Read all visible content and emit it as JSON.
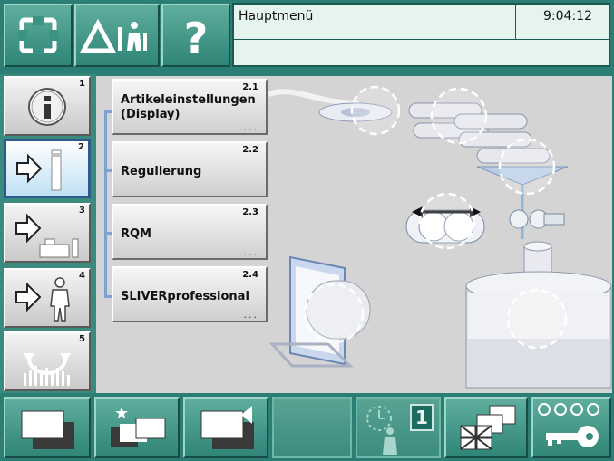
{
  "header": {
    "title": "Hauptmenü",
    "time": "9:04:12",
    "buttons": [
      {
        "name": "fullscreen-button",
        "icon": "fullscreen-icon"
      },
      {
        "name": "alarm-maintenance-button",
        "icon": "delta-person-icon"
      },
      {
        "name": "help-button",
        "icon": "question-icon"
      }
    ]
  },
  "nav": {
    "items": [
      {
        "num": "1",
        "icon": "info-icon",
        "active": false
      },
      {
        "num": "2",
        "icon": "arrow-machine-icon",
        "active": true
      },
      {
        "num": "3",
        "icon": "arrow-factory-icon",
        "active": false
      },
      {
        "num": "4",
        "icon": "arrow-person-icon",
        "active": false
      },
      {
        "num": "5",
        "icon": "cycle-bars-icon",
        "active": false
      }
    ]
  },
  "submenu": {
    "items": [
      {
        "num": "2.1",
        "label_line1": "Artikeleinstellungen",
        "label_line2": "(Display)",
        "dots": "...",
        "has_dots": true
      },
      {
        "num": "2.2",
        "label_line1": "Regulierung",
        "has_dots": false
      },
      {
        "num": "2.3",
        "label_line1": "RQM",
        "dots": "...",
        "has_dots": true
      },
      {
        "num": "2.4",
        "label_line1": "SLIVERprofessional",
        "dots": "...",
        "has_dots": true
      }
    ]
  },
  "footer": {
    "buttons": [
      {
        "name": "window-stack-button",
        "icon": "window-stack-icon"
      },
      {
        "name": "favorite-windows-button",
        "icon": "star-windows-icon"
      },
      {
        "name": "window-back-button",
        "icon": "window-back-icon"
      },
      {
        "name": "empty-slot",
        "icon": ""
      },
      {
        "name": "timer-person-button",
        "icon": "clock-person-icon",
        "badge": "1"
      },
      {
        "name": "language-button",
        "icon": "flag-windows-icon"
      },
      {
        "name": "login-button",
        "icon": "key-icon"
      }
    ]
  },
  "colors": {
    "accent": "#2a7e74",
    "content_bg": "#d4d4d4",
    "active_border": "#2d5a8c"
  }
}
